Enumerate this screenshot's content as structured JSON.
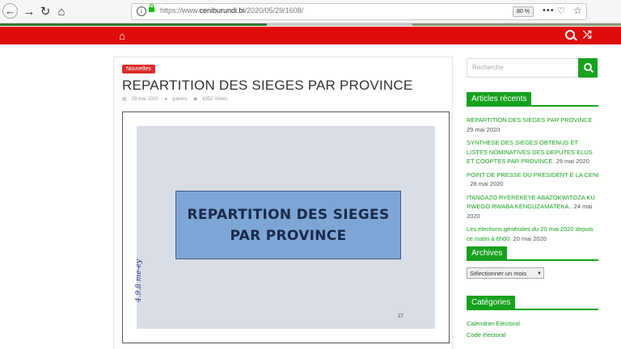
{
  "browser": {
    "url_prefix": "https://www.",
    "url_domain": "ceniburundi.bi",
    "url_path": "/2020/05/29/1608/",
    "zoom": "80 %",
    "icons": [
      "back-arrow-icon",
      "forward-arrow-icon",
      "reload-icon",
      "home-icon",
      "info-icon",
      "lock-icon",
      "more-dots-icon",
      "pocket-icon",
      "bookmark-star-icon"
    ]
  },
  "colors": {
    "nav_red": "#e00c0c",
    "accent_green": "#16a21e",
    "badge_red": "#dd2c2c"
  },
  "nav": {
    "icons": [
      "home-icon",
      "search-icon",
      "shuffle-icon"
    ]
  },
  "post": {
    "category": "Nouvelles",
    "title": "REPARTITION DES SIEGES PAR PROVINCE",
    "date": "29 mai 2020",
    "author": "gakoru",
    "views": "6352 Views",
    "image": {
      "line1": "REPARTITION DES SIEGES",
      "line2": "PAR PROVINCE",
      "handwriting": "4.9.8 me-ey",
      "page_number": "27"
    }
  },
  "sidebar": {
    "search_placeholder": "Recherche",
    "recent_title": "Articles récents",
    "recent": [
      {
        "title": "REPARTITION DES SIEGES PAR PROVINCE",
        "date": "29 mai 2020"
      },
      {
        "title": "SYNTHESE DES SIEGES OBTENUS ET LISTES NOMINATIVES DES DEPUTES ELUS ET COOPTES PAR PROVINCE.",
        "date": "29 mai 2020"
      },
      {
        "title": "POINT DE PRESSE DU PRESIDENT E LA CENI .",
        "date": "28 mai 2020"
      },
      {
        "title": "ITANGAZO RYEREKEYE ABAZOKWITOZA KU RWEGO RWABA KENGUZAMATEKA..",
        "date": "24 mai 2020"
      },
      {
        "title": "Les élections générales du 20 mai 2020 depuis ce matin à 6h00.",
        "date": "20 mai 2020"
      }
    ],
    "archives_title": "Archives",
    "archives_select": "Sélectionner un mois",
    "categories_title": "Catégories",
    "categories": [
      "Calendrier Electoral",
      "Code électoral"
    ]
  }
}
